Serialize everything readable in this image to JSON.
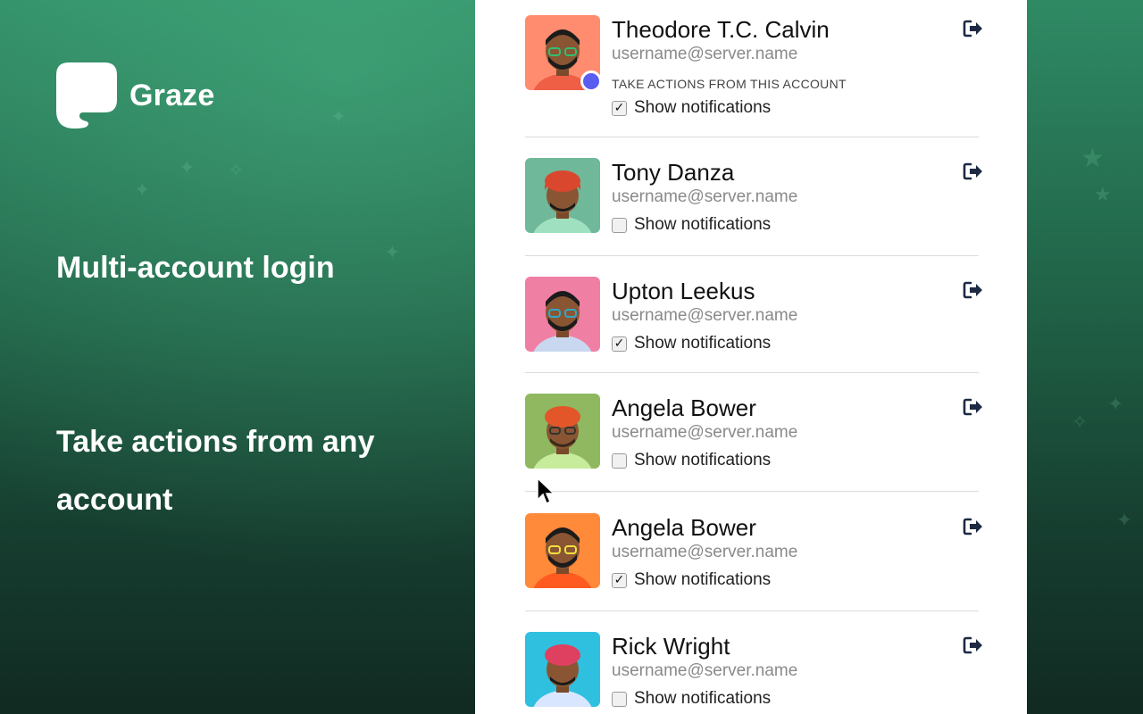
{
  "brand": {
    "name": "Graze",
    "logo_icon": "speech-bubble-icon"
  },
  "promo": {
    "headline": "Multi-account login",
    "subheadline": "Take actions from any account"
  },
  "accounts": [
    {
      "name": "Theodore T.C. Calvin",
      "handle": "username@server.name",
      "avatar_bg": "#ff8c6e",
      "active": true,
      "active_label": "TAKE ACTIONS FROM THIS ACCOUNT",
      "notifications_label": "Show notifications",
      "notifications_checked": true,
      "checkmark": "✓"
    },
    {
      "name": "Tony Danza",
      "handle": "username@server.name",
      "avatar_bg": "#6fb89a",
      "active": false,
      "notifications_label": "Show notifications",
      "notifications_checked": false,
      "checkmark": ""
    },
    {
      "name": "Upton Leekus",
      "handle": "username@server.name",
      "avatar_bg": "#f07fa4",
      "active": false,
      "notifications_label": "Show notifications",
      "notifications_checked": true,
      "checkmark": "✓"
    },
    {
      "name": "Angela Bower",
      "handle": "username@server.name",
      "avatar_bg": "#8fb860",
      "active": false,
      "notifications_label": "Show notifications",
      "notifications_checked": false,
      "checkmark": ""
    },
    {
      "name": "Angela Bower",
      "handle": "username@server.name",
      "avatar_bg": "#ff8a3a",
      "active": false,
      "notifications_label": "Show notifications",
      "notifications_checked": true,
      "checkmark": "✓"
    },
    {
      "name": "Rick Wright",
      "handle": "username@server.name",
      "avatar_bg": "#2fc0e0",
      "active": false,
      "notifications_label": "Show notifications",
      "notifications_checked": false,
      "checkmark": ""
    }
  ],
  "colors": {
    "active_indicator": "#5b5cf0",
    "logout_icon": "#1d2a44",
    "accent_green": "#2f8a64"
  }
}
